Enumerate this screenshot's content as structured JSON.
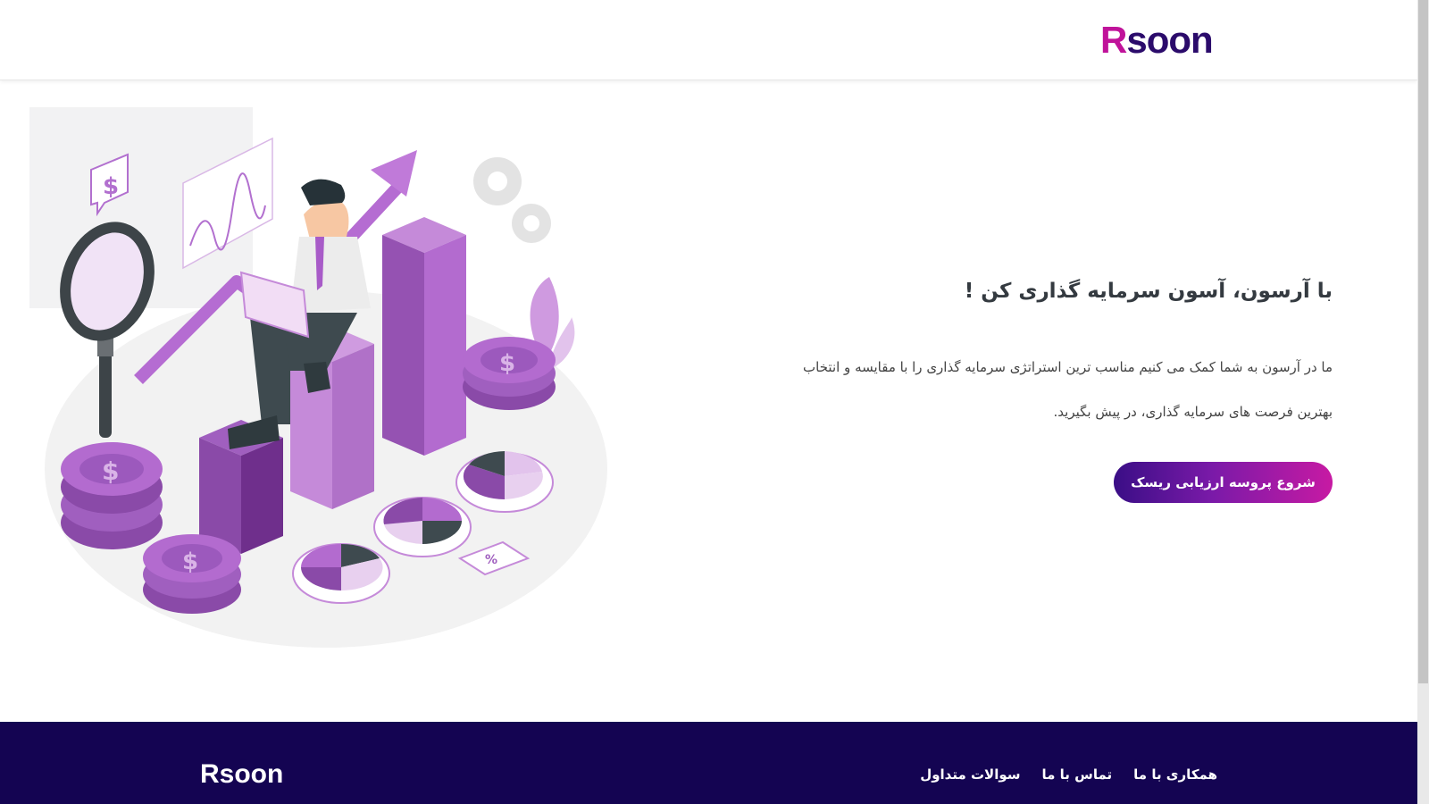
{
  "header": {
    "logo_first": "R",
    "logo_rest": "soon"
  },
  "hero": {
    "title": "با آرسون، آسون سرمایه گذاری کن !",
    "description_line1": "ما در آرسون به شما کمک می کنیم مناسب ترین استراتژی سرمایه گذاری را با مقایسه و انتخاب",
    "description_line2": "بهترین فرصت های سرمایه گذاری، در پیش بگیرید.",
    "cta_label": "شروع پروسه ارزیابی ریسک",
    "illustration": {
      "dollar_sign": "$",
      "percent_tag": "%"
    }
  },
  "footer": {
    "logo": "Rsoon",
    "links": [
      "همکاری با ما",
      "تماس با ما",
      "سوالات متداول"
    ]
  },
  "colors": {
    "brand_pink": "#c0139a",
    "brand_navy": "#2b0b6b",
    "footer_bg": "#140452",
    "accent_purple": "#a85bc8"
  }
}
